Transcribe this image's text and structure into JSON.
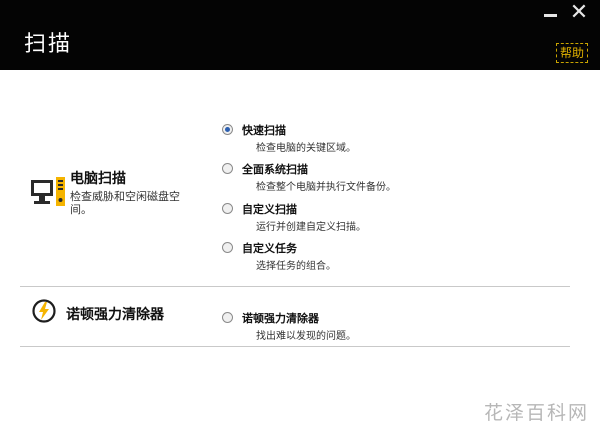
{
  "window": {
    "title": "扫描",
    "help_label": "帮助"
  },
  "sections": [
    {
      "title": "电脑扫描",
      "description": "检查威胁和空闲磁盘空间。",
      "icon": "computer-icon",
      "options": [
        {
          "label": "快速扫描",
          "description": "检查电脑的关键区域。",
          "selected": true
        },
        {
          "label": "全面系统扫描",
          "description": "检查整个电脑并执行文件备份。",
          "selected": false
        },
        {
          "label": "自定义扫描",
          "description": "运行并创建自定义扫描。",
          "selected": false
        },
        {
          "label": "自定义任务",
          "description": "选择任务的组合。",
          "selected": false
        }
      ]
    },
    {
      "title": "诺顿强力清除器",
      "icon": "lightning-bolt-icon",
      "options": [
        {
          "label": "诺顿强力清除器",
          "description": "找出难以发现的问题。",
          "selected": false
        }
      ]
    }
  ],
  "watermark": "花泽百科网",
  "colors": {
    "titlebar": "#040404",
    "help": "#e0b100",
    "radio_selected": "#2c5fb0",
    "icon_accent": "#f5b400"
  }
}
